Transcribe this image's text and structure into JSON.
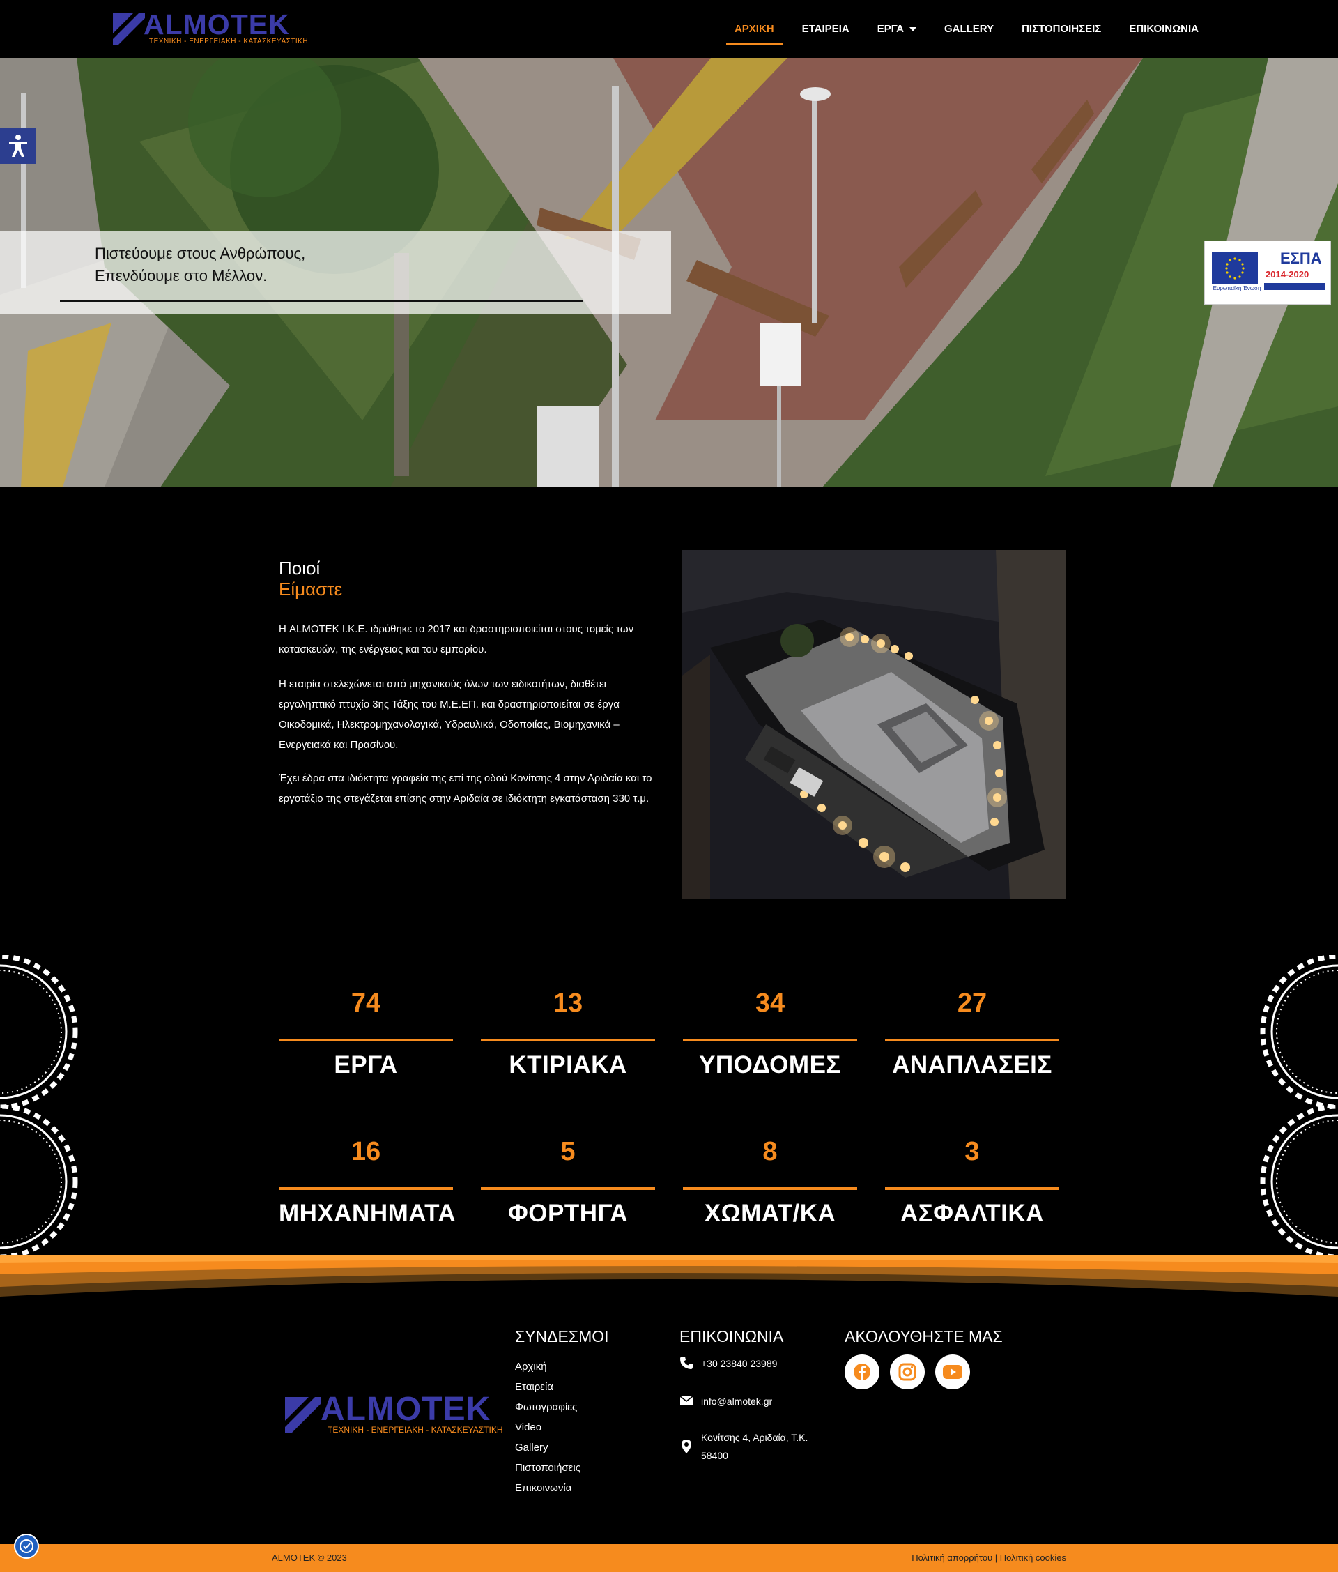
{
  "brand": {
    "name": "ALMOTEK",
    "tagline": "ΤΕΧΝΙΚΗ - ΕΝΕΡΓΕΙΑΚΗ - ΚΑΤΑΣΚΕΥΑΣΤΙΚΗ"
  },
  "nav": {
    "items": [
      {
        "label": "ΑΡΧΙΚΗ",
        "active": true
      },
      {
        "label": "ΕΤΑΙΡΕΙΑ"
      },
      {
        "label": "ΕΡΓΑ",
        "dropdown": true
      },
      {
        "label": "GALLERY"
      },
      {
        "label": "ΠΙΣΤΟΠΟΙΗΣΕΙΣ"
      },
      {
        "label": "ΕΠΙΚΟΙΝΩΝΙΑ"
      }
    ]
  },
  "hero": {
    "line1": "Πιστεύουμε στους Ανθρώπους,",
    "line2": "Επενδύουμε στο Μέλλον.",
    "espa_title": "ΕΣΠΑ",
    "espa_years": "2014-2020",
    "eu_label": "Ευρωπαϊκή Ένωση"
  },
  "about": {
    "title_1": "Ποιοί",
    "title_2": "Είμαστε",
    "p1": "Η ALMOTEK Ι.Κ.Ε. ιδρύθηκε το 2017 και δραστηριοποιείται στους τομείς των κατασκευών, της ενέργειας και του εμπορίου.",
    "p2": "Η εταιρία στελεχώνεται από μηχανικούς όλων των ειδικοτήτων, διαθέτει εργοληπτικό πτυχίο 3ης Τάξης του Μ.Ε.ΕΠ. και δραστηριοποιείται σε έργα Οικοδομικά, Ηλεκτρομηχανολογικά, Υδραυλικά, Οδοποιίας, Βιομηχανικά – Ενεργειακά και Πρασίνου.",
    "p3": "Έχει έδρα στα ιδιόκτητα γραφεία της επί της οδού Κονίτσης 4 στην Αριδαία και το εργοτάξιο της στεγάζεται επίσης στην Αριδαία σε ιδιόκτητη εγκατάσταση 330 τ.μ."
  },
  "counters": [
    {
      "value": "74",
      "label": "ΕΡΓΑ"
    },
    {
      "value": "13",
      "label": "ΚΤΙΡΙΑΚΑ"
    },
    {
      "value": "34",
      "label": "ΥΠΟΔΟΜΕΣ"
    },
    {
      "value": "27",
      "label": "ΑΝΑΠΛΑΣΕΙΣ"
    },
    {
      "value": "16",
      "label": "ΜΗΧΑΝΗΜΑΤΑ"
    },
    {
      "value": "5",
      "label": "ΦΟΡΤΗΓΑ"
    },
    {
      "value": "8",
      "label": "ΧΩΜΑΤ/ΚΑ"
    },
    {
      "value": "3",
      "label": "ΑΣΦΑΛΤΙΚΑ"
    }
  ],
  "footer": {
    "links_title": "ΣΥΝΔΕΣΜΟΙ",
    "links": [
      "Αρχική",
      "Εταιρεία",
      "Φωτογραφίες",
      "Video",
      "Gallery",
      "Πιστοποιήσεις",
      "Επικοινωνία"
    ],
    "contact_title": "ΕΠΙΚΟΙΝΩΝΙΑ",
    "phone": "+30 23840 23989",
    "email": "info@almotek.gr",
    "address": "Κονίτσης 4, Αριδαία, Τ.Κ. 58400",
    "follow_title": "ΑΚΟΛΟΥΘΗΣΤΕ ΜΑΣ",
    "social_icons": [
      "facebook-icon",
      "instagram-icon",
      "youtube-icon"
    ]
  },
  "bottom": {
    "copyright": "ALMOTEK © 2023",
    "privacy": "Πολιτική απορρήτου",
    "separator": "|",
    "cookies": "Πολιτική cookies"
  },
  "colors": {
    "accent": "#f68b1e",
    "brand_blue": "#3b3ba8",
    "background": "#000000"
  }
}
